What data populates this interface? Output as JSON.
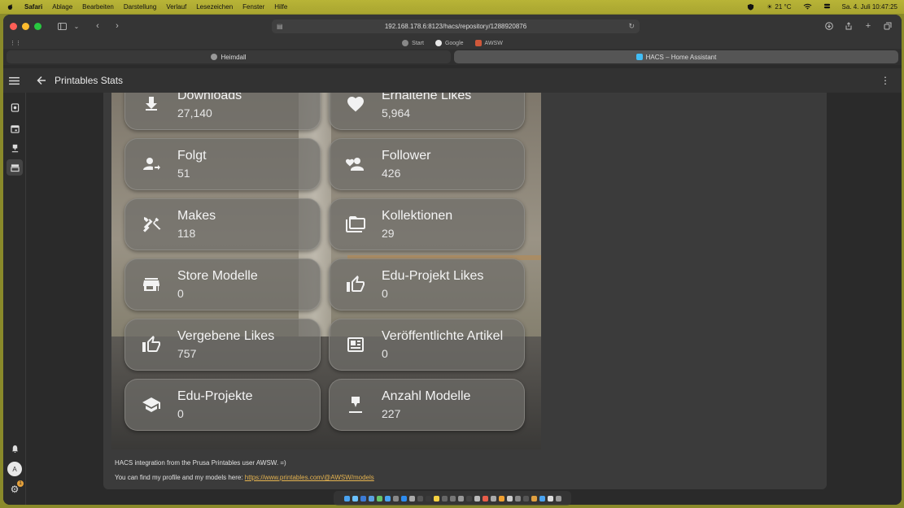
{
  "menubar": {
    "app": "Safari",
    "items": [
      "Ablage",
      "Bearbeiten",
      "Darstellung",
      "Verlauf",
      "Lesezeichen",
      "Fenster",
      "Hilfe"
    ],
    "weather": "21 °C",
    "datetime": "Sa. 4. Juli  10:47:25"
  },
  "browser": {
    "url": "192.168.178.6:8123/hacs/repository/1288920876",
    "favorites": [
      "Start",
      "Google",
      "AWSW"
    ],
    "tabs": [
      {
        "label": "Heimdall",
        "active": false
      },
      {
        "label": "HACS – Home Assistant",
        "active": true
      }
    ]
  },
  "header": {
    "title": "Printables Stats"
  },
  "tiles": [
    {
      "label": "Downloads",
      "value": "27,140",
      "icon": "download-icon"
    },
    {
      "label": "Erhaltene Likes",
      "value": "5,964",
      "icon": "heart-icon"
    },
    {
      "label": "Folgt",
      "value": "51",
      "icon": "account-arrow-right-icon"
    },
    {
      "label": "Follower",
      "value": "426",
      "icon": "account-heart-icon"
    },
    {
      "label": "Makes",
      "value": "118",
      "icon": "tools-icon"
    },
    {
      "label": "Kollektionen",
      "value": "29",
      "icon": "folder-multiple-icon"
    },
    {
      "label": "Store Modelle",
      "value": "0",
      "icon": "store-icon"
    },
    {
      "label": "Edu-Projekt Likes",
      "value": "0",
      "icon": "thumb-up-outline-icon"
    },
    {
      "label": "Vergebene Likes",
      "value": "757",
      "icon": "thumb-up-outline-icon"
    },
    {
      "label": "Veröffentlichte Artikel",
      "value": "0",
      "icon": "newspaper-icon"
    },
    {
      "label": "Edu-Projekte",
      "value": "0",
      "icon": "school-icon"
    },
    {
      "label": "Anzahl Modelle",
      "value": "227",
      "icon": "printer-3d-nozzle-icon"
    }
  ],
  "footer": {
    "line1": "HACS integration from the Prusa Printables user AWSW. =)",
    "line2_prefix": "You can find my profile and my models here: ",
    "link": "https://www.printables.com/@AWSW/models"
  },
  "sidebar": {
    "avatar_letter": "A",
    "settings_badge": "1"
  },
  "colors": {
    "accent": "#e6b450",
    "menubar": "#b0ac33"
  }
}
